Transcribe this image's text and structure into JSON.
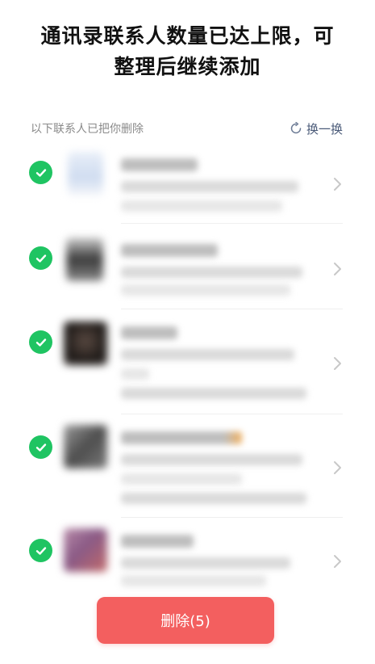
{
  "title": {
    "line1": "通讯录联系人数量已达上限，可",
    "line2": "整理后继续添加"
  },
  "section": {
    "label": "以下联系人已把你删除",
    "refresh_label": "换一换",
    "refresh_icon": "refresh-icon"
  },
  "contacts_selected": 5,
  "colors": {
    "check_green": "#1fc462",
    "delete_red": "#f35f5f",
    "refresh_text": "#4a5a78"
  },
  "footer": {
    "delete_label": "删除(5)"
  }
}
